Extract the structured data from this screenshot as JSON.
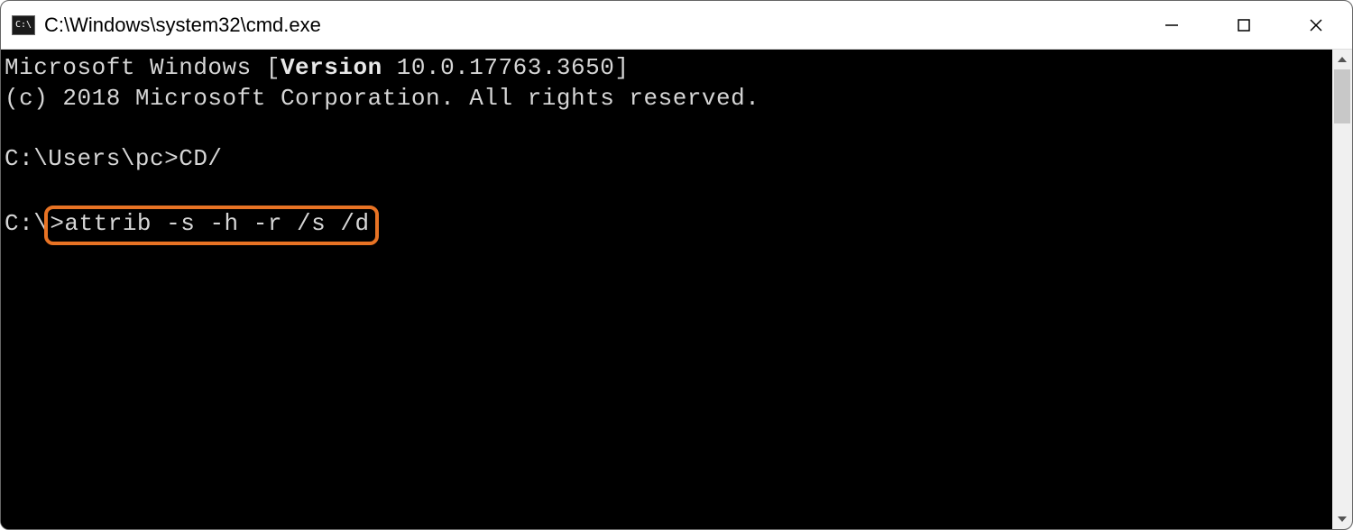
{
  "titlebar": {
    "icon_label": "C:\\",
    "title": "C:\\Windows\\system32\\cmd.exe"
  },
  "terminal": {
    "line1_pre": "Microsoft Windows [",
    "line1_bold": "Version",
    "line1_post": " 10.0.17763.3650]",
    "line2": "(c) 2018 Microsoft Corporation. All rights reserved.",
    "blank": "",
    "line3": "C:\\Users\\pc>CD/",
    "line4_prompt": "C:\\",
    "line4_cmd": ">attrib -s -h -r /s /d"
  }
}
